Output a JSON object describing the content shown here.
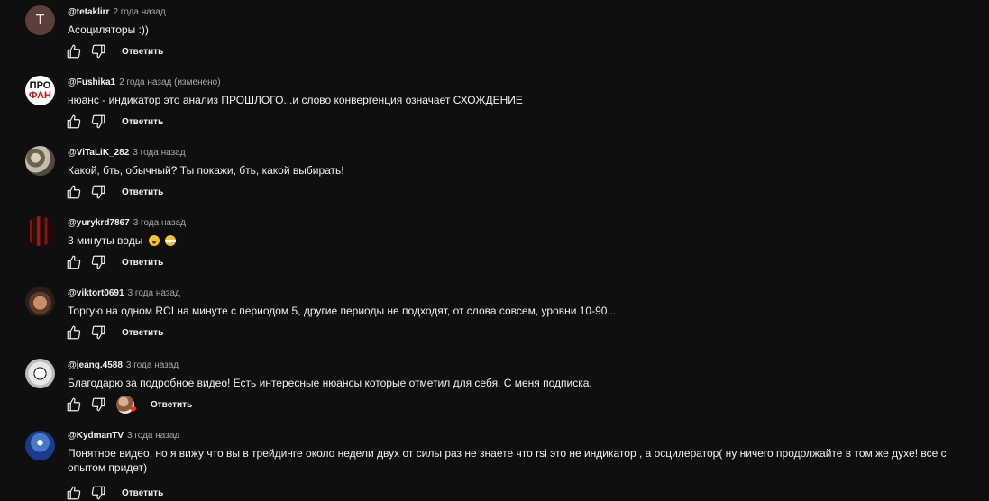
{
  "comments": [
    {
      "author": "@tetaklirr",
      "time": "2 года назад",
      "text": "Асоциляторы :))",
      "reply": "Ответить",
      "avatar_letter": "T",
      "avatar_color": "#5a4038"
    },
    {
      "author": "@Fushika1",
      "time": "2 года назад (изменено)",
      "text": "нюанс - индикатор это анализ ПРОШЛОГО...и слово конвергенция означает СХОЖДЕНИЕ",
      "reply": "Ответить",
      "avatar_text_top": "ПРО",
      "avatar_text_bottom": "ФАН"
    },
    {
      "author": "@ViTaLiK_282",
      "time": "3 года назад",
      "text": "Какой, бть, обычный? Ты покажи, бть, какой выбирать!",
      "reply": "Ответить"
    },
    {
      "author": "@yurykrd7867",
      "time": "3 года назад",
      "text": "3 минуты воды",
      "reply": "Ответить"
    },
    {
      "author": "@viktort0691",
      "time": "3 года назад",
      "text": "Торгую на одном RCI на  минуте с периодом 5, другие периоды не подходят, от слова совсем, уровни 10-90...",
      "reply": "Ответить"
    },
    {
      "author": "@jeang.4588",
      "time": "3 года назад",
      "text": "Благодарю за подробное видео! Есть интересные нюансы которые отметил для себя. С меня подписка.",
      "reply": "Ответить",
      "hearted": true
    },
    {
      "author": "@KydmanTV",
      "time": "3 года назад",
      "text": "Понятное видео, но я вижу что вы  в трейдинге около недели двух от силы раз не знаете что rsi это не индикатор , а осцилератор( ну ничего продолжайте в том же духе! все с опытом придет)",
      "reply": "Ответить"
    }
  ],
  "icons": {
    "like": "thumb-up-icon",
    "dislike": "thumb-down-icon",
    "heart": "heart-icon"
  },
  "colors": {
    "background": "#0f0f0f",
    "text": "#f1f1f1",
    "meta": "#aaaaaa",
    "heart": "#ff2b2b"
  }
}
